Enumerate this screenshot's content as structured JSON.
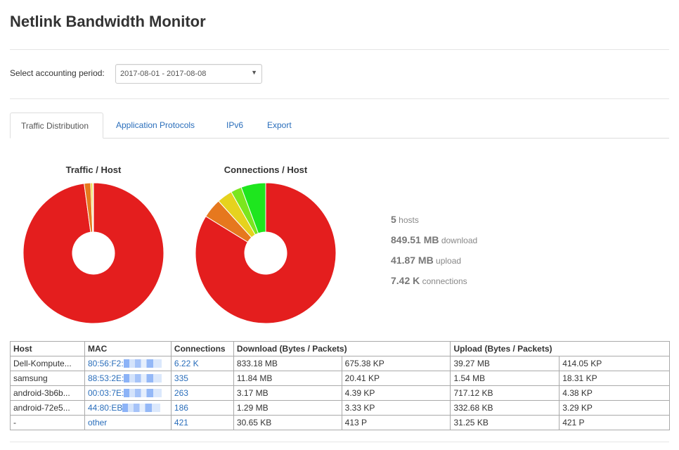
{
  "page": {
    "title": "Netlink Bandwidth Monitor"
  },
  "period": {
    "label": "Select accounting period:",
    "value": "2017-08-01 - 2017-08-08"
  },
  "tabs": [
    {
      "label": "Traffic Distribution",
      "active": true
    },
    {
      "label": "Application Protocols",
      "active": false
    },
    {
      "label": "IPv6",
      "active": false
    },
    {
      "label": "Export",
      "active": false
    }
  ],
  "colors": {
    "link": "#2a6ebb"
  },
  "chart_data": [
    {
      "type": "pie",
      "title": "Traffic / Host",
      "slices": [
        {
          "label": "Dell-Kompute...",
          "value": 872.45,
          "color": "#e41e1e"
        },
        {
          "label": "samsung",
          "value": 13.38,
          "color": "#e6781e"
        },
        {
          "label": "android-3b6b...",
          "value": 3.87,
          "color": "#e6d21e"
        },
        {
          "label": "android-72e5...",
          "value": 1.61,
          "color": "#7be61e"
        },
        {
          "label": "-",
          "value": 0.06,
          "color": "#1ee61e"
        }
      ]
    },
    {
      "type": "pie",
      "title": "Connections / Host",
      "slices": [
        {
          "label": "Dell-Kompute...",
          "value": 6220,
          "color": "#e41e1e"
        },
        {
          "label": "samsung",
          "value": 335,
          "color": "#e6781e"
        },
        {
          "label": "android-3b6b...",
          "value": 263,
          "color": "#e6d21e"
        },
        {
          "label": "android-72e5...",
          "value": 186,
          "color": "#7be61e"
        },
        {
          "label": "-",
          "value": 421,
          "color": "#1ee61e"
        }
      ]
    }
  ],
  "stats": [
    {
      "value": "5",
      "unit": "hosts"
    },
    {
      "value": "849.51 MB",
      "unit": "download"
    },
    {
      "value": "41.87 MB",
      "unit": "upload"
    },
    {
      "value": "7.42 K",
      "unit": "connections"
    }
  ],
  "table": {
    "headers": {
      "host": "Host",
      "mac": "MAC",
      "connections": "Connections",
      "download": "Download (Bytes / Packets)",
      "upload": "Upload (Bytes / Packets)"
    },
    "rows": [
      {
        "host": "Dell-Kompute...",
        "mac": "80:56:F2:",
        "mac_masked": true,
        "connections": "6.22 K",
        "dl_bytes": "833.18 MB",
        "dl_packets": "675.38 KP",
        "ul_bytes": "39.27 MB",
        "ul_packets": "414.05 KP"
      },
      {
        "host": "samsung",
        "mac": "88:53:2E:",
        "mac_masked": true,
        "connections": "335",
        "dl_bytes": "11.84 MB",
        "dl_packets": "20.41 KP",
        "ul_bytes": "1.54 MB",
        "ul_packets": "18.31 KP"
      },
      {
        "host": "android-3b6b...",
        "mac": "00:03:7E:",
        "mac_masked": true,
        "connections": "263",
        "dl_bytes": "3.17 MB",
        "dl_packets": "4.39 KP",
        "ul_bytes": "717.12 KB",
        "ul_packets": "4.38 KP"
      },
      {
        "host": "android-72e5...",
        "mac": "44:80:EB",
        "mac_masked": true,
        "connections": "186",
        "dl_bytes": "1.29 MB",
        "dl_packets": "3.33 KP",
        "ul_bytes": "332.68 KB",
        "ul_packets": "3.29 KP"
      },
      {
        "host": "-",
        "mac": "other",
        "mac_masked": false,
        "connections": "421",
        "dl_bytes": "30.65 KB",
        "dl_packets": "413 P",
        "ul_bytes": "31.25 KB",
        "ul_packets": "421 P"
      }
    ]
  }
}
